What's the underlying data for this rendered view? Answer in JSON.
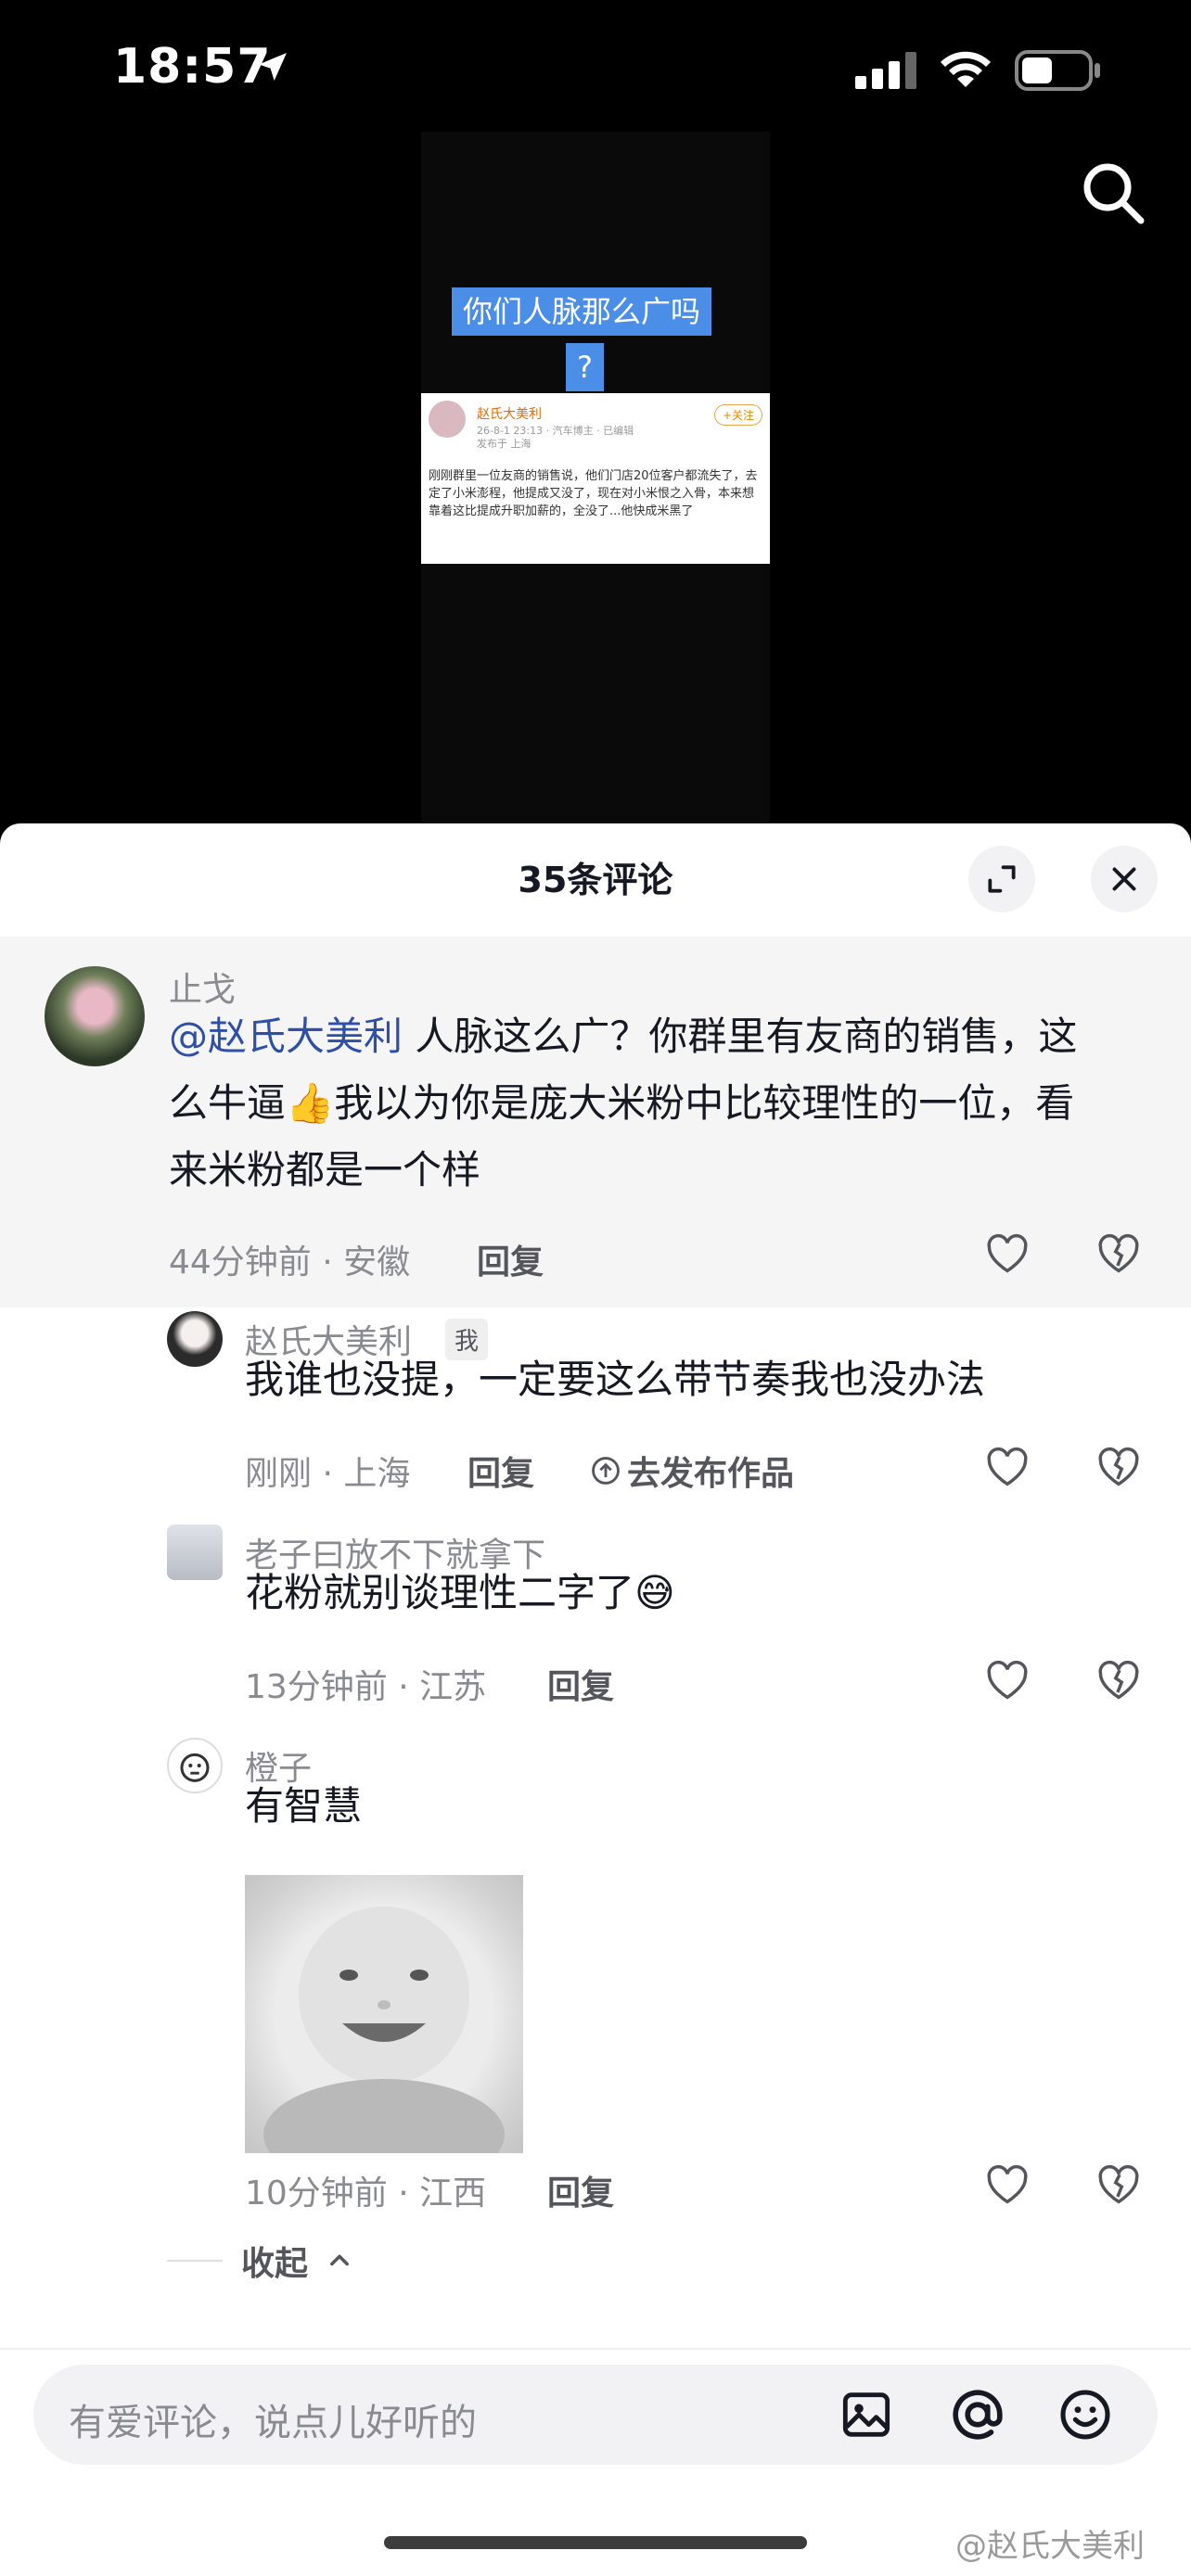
{
  "status_bar": {
    "time": "18:57"
  },
  "video": {
    "caption1": "你们人脉那么广吗",
    "caption2": "?",
    "weibo": {
      "name": "赵氏大美利",
      "meta": "26-8-1 23:13 · 汽车博主 · 已编辑",
      "location": "发布于 上海",
      "follow": "+关注",
      "text": "刚刚群里一位友商的销售说，他们门店20位客户都流失了，去定了小米澎程，他提成又没了，现在对小米恨之入骨，本来想靠着这比提成升职加薪的，全没了...他快成米黑了"
    }
  },
  "sheet": {
    "title": "35条评论"
  },
  "comments": [
    {
      "user": "止戈",
      "mention": "@赵氏大美利",
      "text": " 人脉这么广？你群里有友商的销售，这么牛逼👍我以为你是庞大米粉中比较理性的一位，看来米粉都是一个样",
      "meta": "44分钟前 · 安徽",
      "reply": "回复"
    },
    {
      "user": "赵氏大美利",
      "badge": "我",
      "text": "我谁也没提，一定要这么带节奏我也没办法",
      "meta": "刚刚 · 上海",
      "reply": "回复",
      "publish": "去发布作品"
    },
    {
      "user": "老子曰放不下就拿下",
      "text": "花粉就别谈理性二字了😅",
      "meta": "13分钟前 · 江苏",
      "reply": "回复"
    },
    {
      "user": "橙子",
      "text": "有智慧",
      "meta": "10分钟前 · 江西",
      "reply": "回复"
    }
  ],
  "collapse": {
    "label": "收起"
  },
  "input": {
    "placeholder": "有爱评论，说点儿好听的"
  },
  "watermark": "@赵氏大美利",
  "colors": {
    "mention": "#2e4fa8",
    "caption_bg": "#4a8ee8"
  }
}
